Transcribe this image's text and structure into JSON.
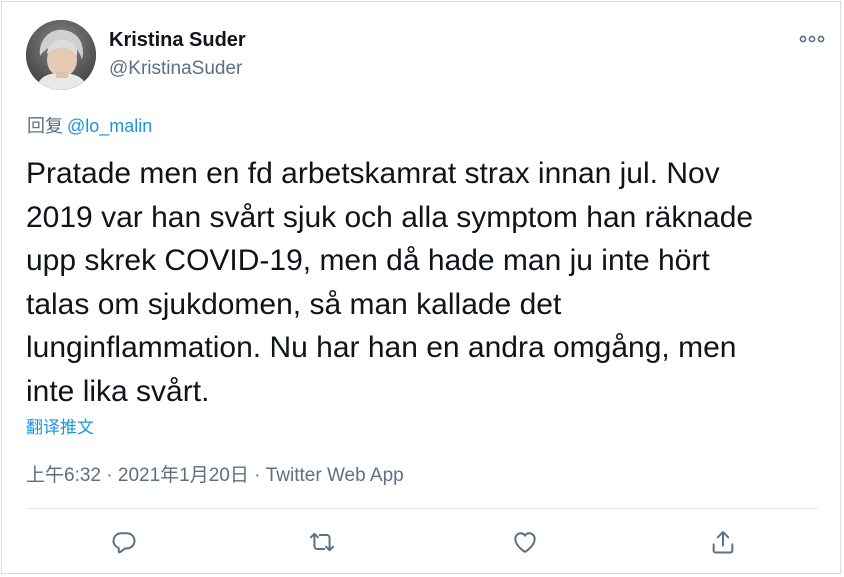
{
  "author": {
    "display_name": "Kristina Suder",
    "handle": "@KristinaSuder"
  },
  "reply": {
    "prefix": "回复",
    "mention": "@lo_malin"
  },
  "tweet": {
    "lines": [
      "Pratade men en fd arbetskamrat strax innan jul. Nov",
      "2019 var han svårt sjuk och alla symptom han räknade",
      "upp skrek COVID-19, men då hade man ju inte hört",
      "talas om sjukdomen, så man kallade det",
      "lunginflammation. Nu har han en andra omgång, men",
      "inte lika svårt."
    ],
    "translate_label": "翻译推文"
  },
  "meta": {
    "time": "上午6:32",
    "separator": "·",
    "date": "2021年1月20日",
    "source": "Twitter Web App"
  },
  "icons": {
    "more": "more-icon",
    "reply": "reply-icon",
    "retweet": "retweet-icon",
    "like": "heart-icon",
    "share": "share-icon"
  },
  "colors": {
    "text": "#0f1419",
    "secondary": "#5b7083",
    "link": "#1b95e0",
    "divider": "#e1e8ed",
    "icon": "#5b7083"
  }
}
